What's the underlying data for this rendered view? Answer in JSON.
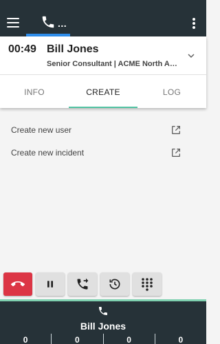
{
  "call": {
    "timer": "00:49",
    "caller_name": "Bill Jones",
    "caller_subtitle": "Senior Consultant | ACME North America",
    "tab_overflow": "..."
  },
  "tabs": [
    {
      "label": "INFO",
      "active": false
    },
    {
      "label": "CREATE",
      "active": true
    },
    {
      "label": "LOG",
      "active": false
    }
  ],
  "actions": [
    {
      "label": "Create new user",
      "icon": "external-link-icon"
    },
    {
      "label": "Create new incident",
      "icon": "external-link-icon"
    }
  ],
  "controls": [
    {
      "name": "hangup-button",
      "icon": "hangup-icon"
    },
    {
      "name": "hold-button",
      "icon": "pause-icon"
    },
    {
      "name": "transfer-button",
      "icon": "call-forward-icon"
    },
    {
      "name": "history-button",
      "icon": "history-icon"
    },
    {
      "name": "dialpad-button",
      "icon": "dialpad-icon"
    }
  ],
  "footer": {
    "name": "Bill Jones",
    "counts": [
      "0",
      "0",
      "0",
      "0"
    ]
  },
  "colors": {
    "topbar": "#263238",
    "tab_indicator_top": "#2f8eed",
    "tab_indicator_active": "#4fc3a1",
    "hangup": "#dc3545",
    "footer_accent": "#7fd1b0"
  }
}
